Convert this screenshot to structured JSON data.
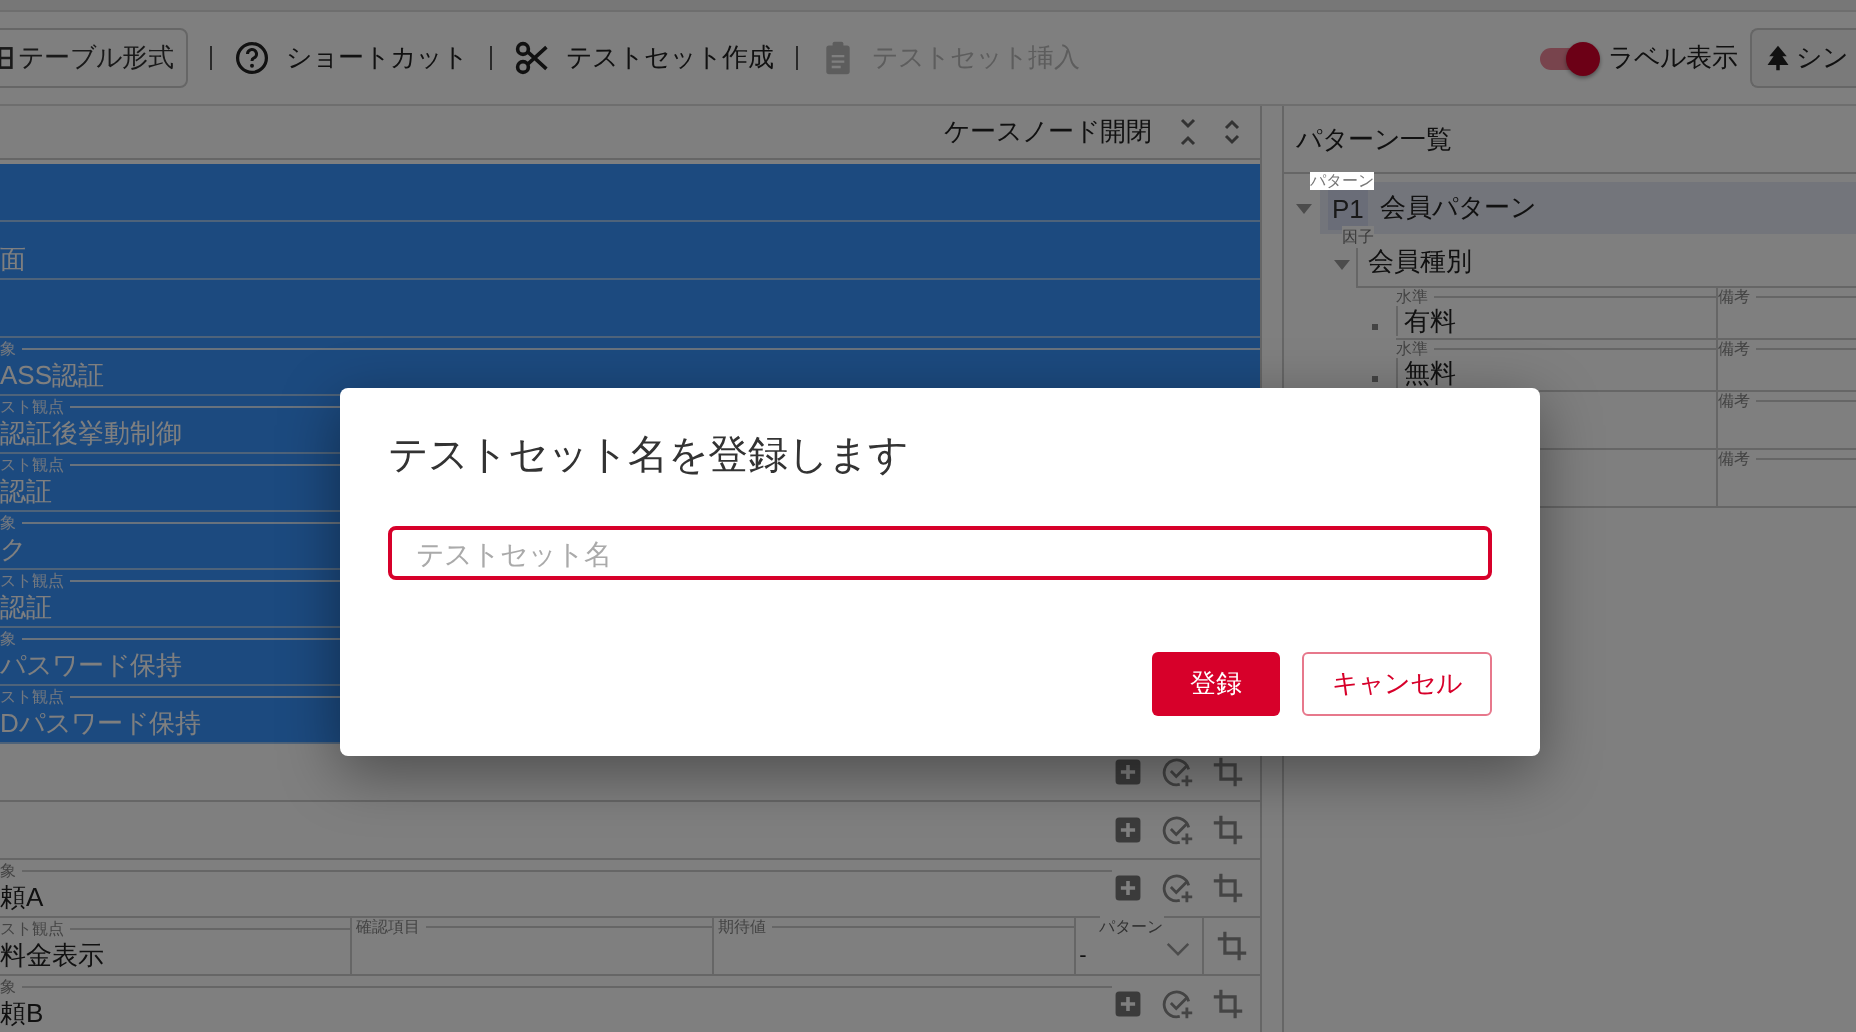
{
  "toolbar": {
    "items": [
      {
        "kind": "outlined",
        "label": "テーブル形式",
        "disabled": false
      },
      {
        "kind": "link",
        "label": "ショートカット",
        "disabled": false
      },
      {
        "kind": "link",
        "label": "テストセット作成",
        "disabled": false
      },
      {
        "kind": "link",
        "label": "テストセット挿入",
        "disabled": true
      }
    ],
    "toggle": {
      "label": "ラベル表示",
      "on": true
    },
    "tree_button": {
      "label": "シン"
    }
  },
  "left_panel": {
    "header": "ケースノード開閉",
    "rows": [
      {
        "kind": "node",
        "selected": true
      },
      {
        "kind": "node",
        "selected": true,
        "text": "面"
      },
      {
        "kind": "node",
        "selected": true
      },
      {
        "kind": "node",
        "selected": true,
        "label": "象",
        "text": "ASS認証"
      },
      {
        "kind": "node",
        "selected": true,
        "label": "スト観点",
        "text": "認証後挙動制御"
      },
      {
        "kind": "node",
        "selected": true,
        "label": "スト観点",
        "text": "認証"
      },
      {
        "kind": "node",
        "selected": true,
        "label": "象",
        "text": "ク"
      },
      {
        "kind": "node",
        "selected": true,
        "label": "スト観点",
        "text": "認証"
      },
      {
        "kind": "node",
        "selected": true,
        "label": "象",
        "text": "パスワード保持"
      },
      {
        "kind": "node",
        "selected": true,
        "label": "スト観点",
        "text": "Dパスワード保持"
      },
      {
        "kind": "node",
        "selected": false,
        "actions": true
      },
      {
        "kind": "node",
        "selected": false,
        "actions": true
      },
      {
        "kind": "node",
        "selected": false,
        "label": "象",
        "text": "頼A",
        "actions": true
      },
      {
        "kind": "detail",
        "selected": false,
        "label": "スト観点",
        "text": "料金表示",
        "fields": [
          {
            "label": "確認項目"
          },
          {
            "label": "期待値"
          }
        ],
        "select": {
          "label": "パターン",
          "value": "-"
        }
      },
      {
        "kind": "node",
        "selected": false,
        "label": "象",
        "text": "頼B",
        "actions": true
      }
    ]
  },
  "right_panel": {
    "title": "パターン一覧",
    "pattern": {
      "label": "パターン",
      "id": "P1",
      "name": "会員パターン",
      "expanded": true
    },
    "factor": {
      "label": "因子",
      "name": "会員種別",
      "expanded": true
    },
    "levels": [
      {
        "label": "水準",
        "name": "有料",
        "note_label": "備考"
      },
      {
        "label": "水準",
        "name": "無料",
        "note_label": "備考"
      }
    ],
    "extra_rows": [
      {
        "note_label": "備考"
      },
      {
        "note_label": "備考"
      }
    ]
  },
  "modal": {
    "title": "テストセット名を登録します",
    "placeholder": "テストセット名",
    "buttons": [
      {
        "kind": "primary",
        "label": "登録"
      },
      {
        "kind": "secondary",
        "label": "キャンセル"
      }
    ]
  }
}
